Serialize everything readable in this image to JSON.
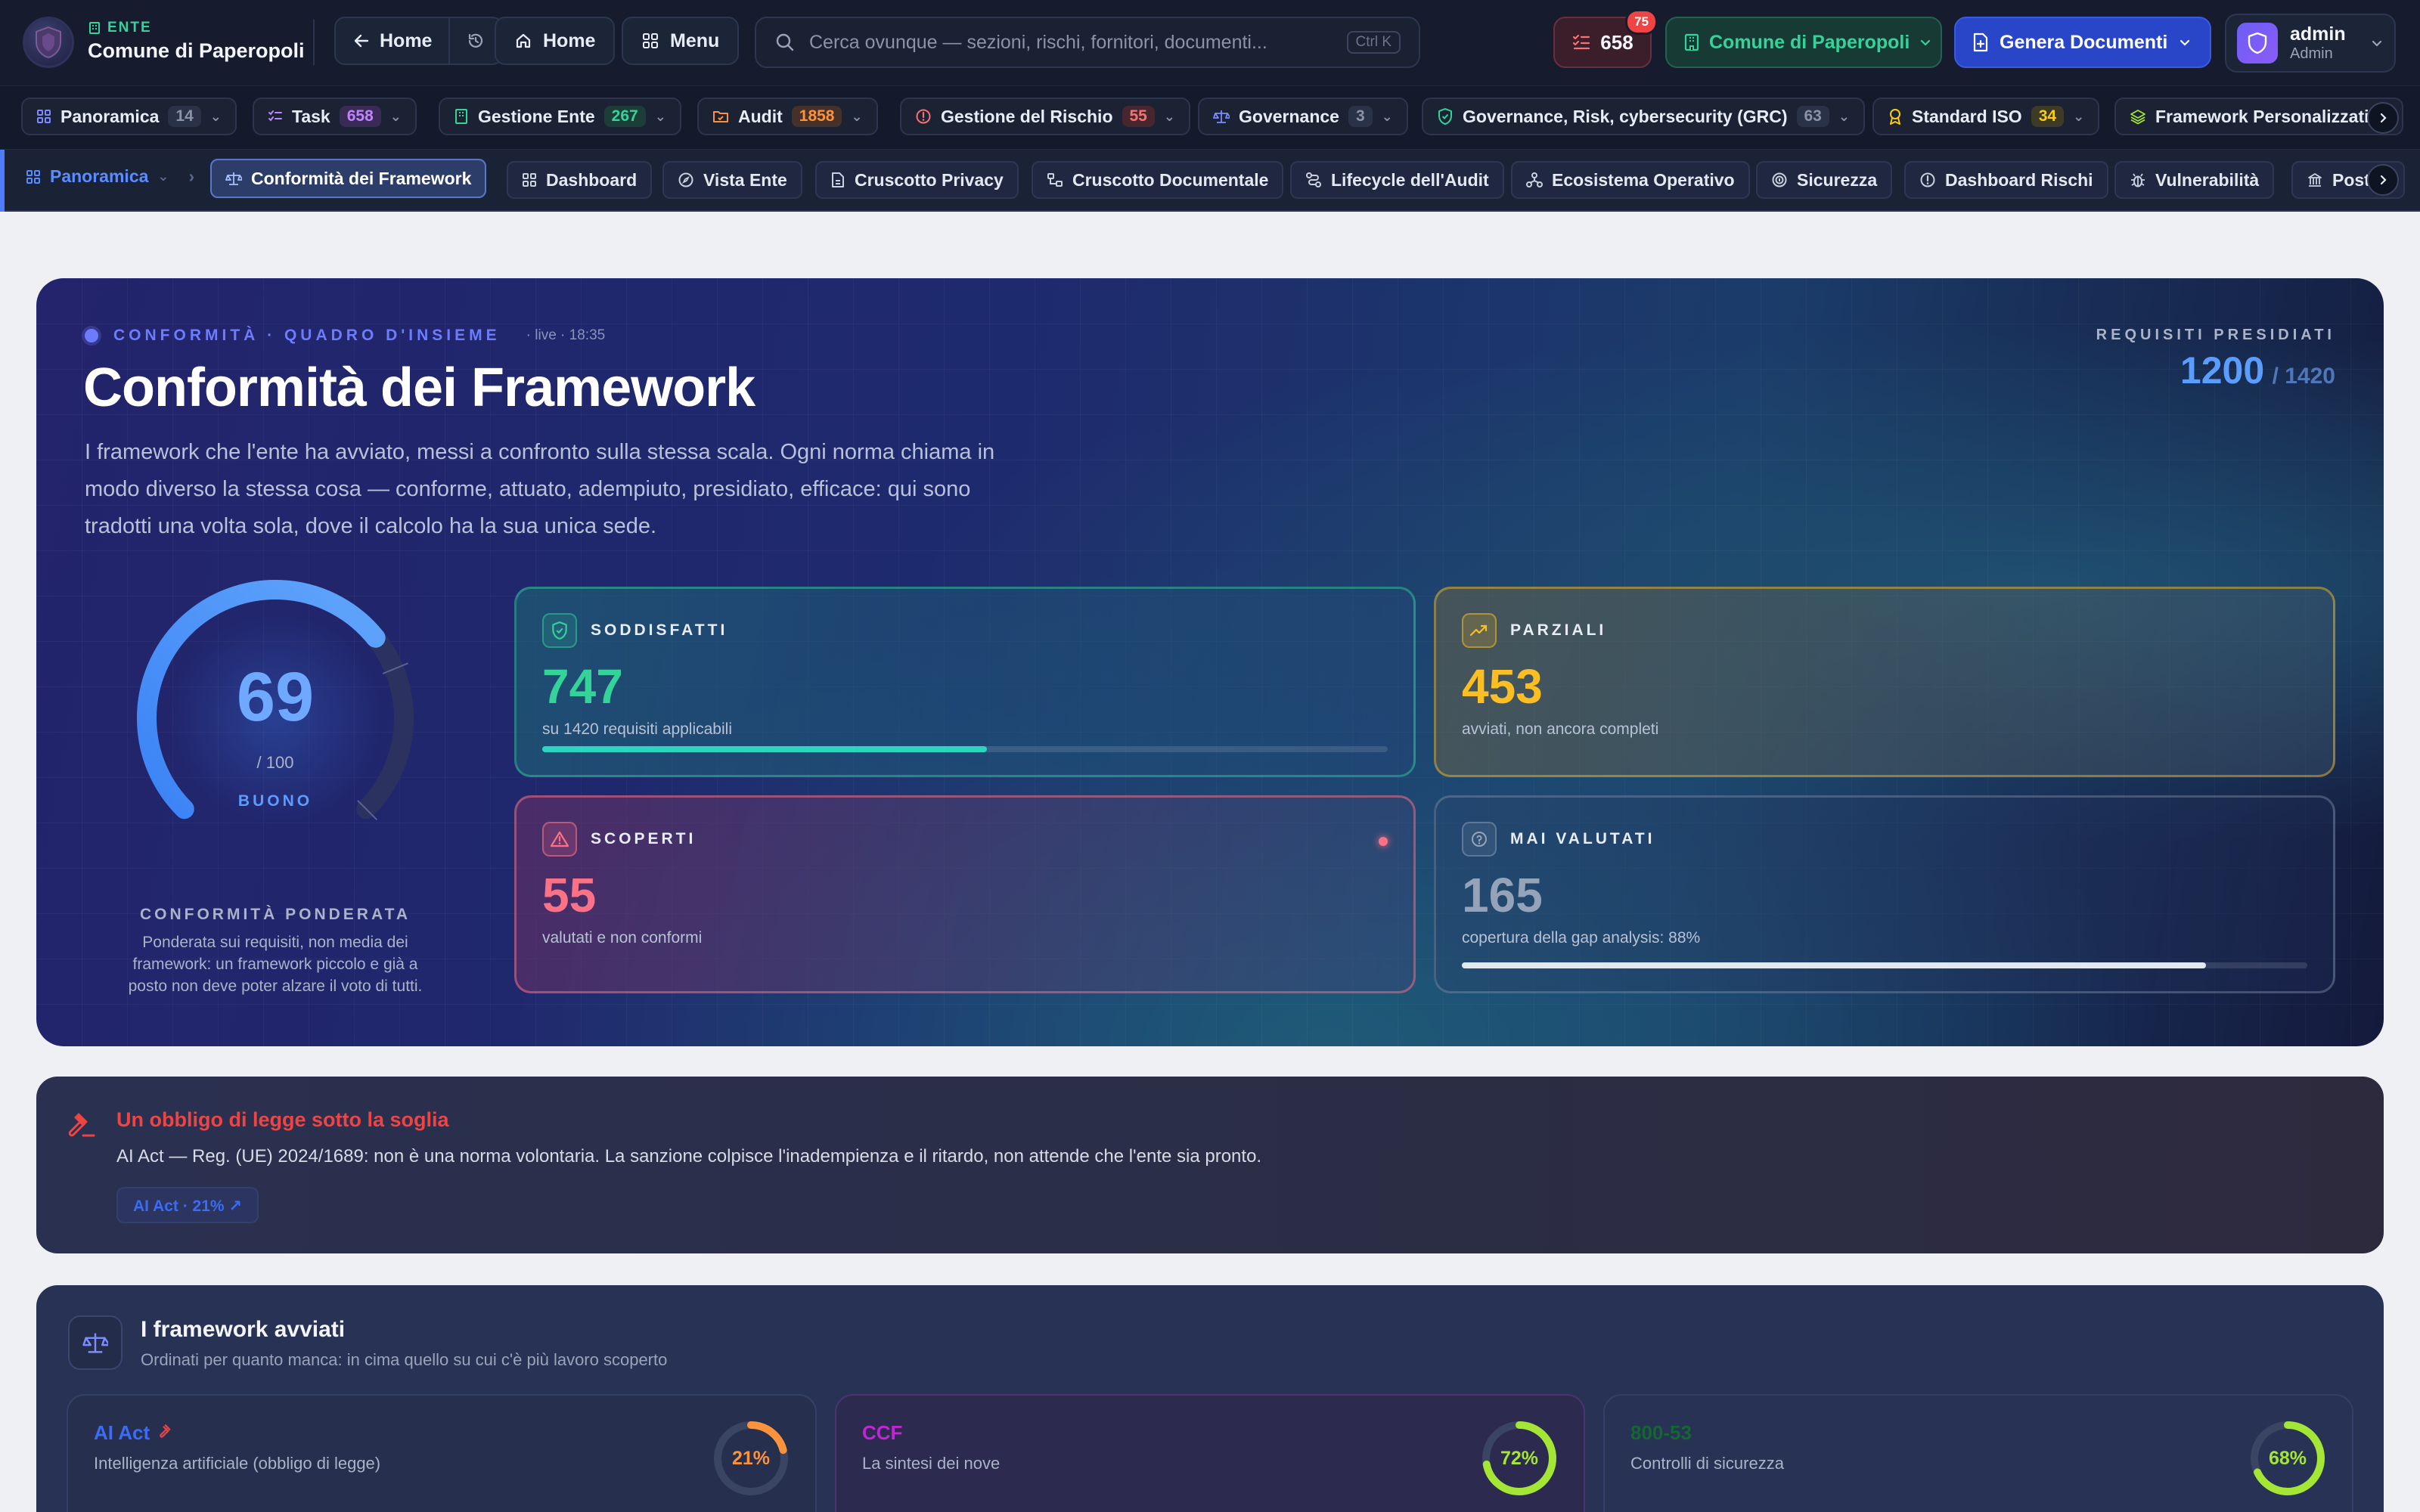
{
  "header": {
    "entity_kicker": "ENTE",
    "entity_name": "Comune di Paperopoli",
    "back_label": "Home",
    "home_label": "Home",
    "menu_label": "Menu",
    "search_placeholder": "Cerca ovunque — sezioni, rischi, fornitori, documenti...",
    "search_shortcut": "Ctrl K",
    "tasks_count": "658",
    "tasks_badge": "75",
    "entity_selector": "Comune di Paperopoli",
    "generate_docs": "Genera Documenti",
    "user_name": "admin",
    "user_role": "Admin"
  },
  "module_tabs": [
    {
      "label": "Panoramica",
      "count": "14",
      "icon": "grid-icon",
      "count_color": "#8a93a8",
      "count_bg": "#2a3248"
    },
    {
      "label": "Task",
      "count": "658",
      "icon": "tasks-icon",
      "count_color": "#c084fc",
      "count_bg": "#3a2a56"
    },
    {
      "label": "Gestione Ente",
      "count": "267",
      "icon": "building-icon",
      "count_color": "#34d399",
      "count_bg": "#1d3d38"
    },
    {
      "label": "Audit",
      "count": "1858",
      "icon": "folder-icon",
      "count_color": "#fb923c",
      "count_bg": "#45302a"
    },
    {
      "label": "Gestione del Rischio",
      "count": "55",
      "icon": "alert-circle-icon",
      "count_color": "#f87171",
      "count_bg": "#47272f"
    },
    {
      "label": "Governance",
      "count": "3",
      "icon": "scale-icon",
      "count_color": "#8a93a8",
      "count_bg": "#2a3248"
    },
    {
      "label": "Governance, Risk, cybersecurity (GRC)",
      "count": "63",
      "icon": "shield-check-icon",
      "count_color": "#8a93a8",
      "count_bg": "#2a3248"
    },
    {
      "label": "Standard ISO",
      "count": "34",
      "icon": "award-icon",
      "count_color": "#facc15",
      "count_bg": "#3d3a26"
    },
    {
      "label": "Framework Personalizzati",
      "count": "",
      "icon": "layers-icon",
      "count_color": "#8a93a8",
      "count_bg": "#2a3248"
    }
  ],
  "sub_nav": {
    "breadcrumb_root": "Panoramica",
    "active": "Conformità dei Framework",
    "items": [
      "Dashboard",
      "Vista Ente",
      "Cruscotto Privacy",
      "Cruscotto Documentale",
      "Lifecycle dell'Audit",
      "Ecosistema Operativo",
      "Sicurezza",
      "Dashboard Rischi",
      "Vulnerabilità",
      "Post"
    ]
  },
  "hero": {
    "kicker": "CONFORMITÀ · QUADRO D'INSIEME",
    "live": "· live · 18:35",
    "title": "Conformità dei Framework",
    "description_lines": [
      "I framework che l'ente ha avviato, messi a confronto sulla stessa scala. Ogni norma chiama in",
      "modo diverso la stessa cosa — conforme, attuato, adempiuto, presidiato, efficace: qui sono",
      "tradotti una volta sola, dove il calcolo ha la sua unica sede."
    ],
    "requirements_label": "REQUISITI PRESIDIATI",
    "requirements_value": "1200",
    "requirements_total": "/ 1420",
    "gauge_value": "69",
    "gauge_max": "/ 100",
    "gauge_fraction": 0.69,
    "gauge_rating": "BUONO",
    "gauge_caption": "CONFORMITÀ PONDERATA",
    "gauge_note_lines": [
      "Ponderata sui requisiti, non media dei",
      "framework: un framework piccolo e già a",
      "posto non deve poter alzare il voto di tutti."
    ]
  },
  "kpis": {
    "satisfied": {
      "label": "SODDISFATTI",
      "value": "747",
      "sub": "su 1420 requisiti applicabili",
      "progress": 0.526,
      "color": "#34d399"
    },
    "partial": {
      "label": "PARZIALI",
      "value": "453",
      "sub": "avviati, non ancora completi",
      "color": "#fbbf24"
    },
    "uncovered": {
      "label": "SCOPERTI",
      "value": "55",
      "sub": "valutati e non conformi",
      "color": "#fb7185"
    },
    "never": {
      "label": "MAI VALUTATI",
      "value": "165",
      "sub": "copertura della gap analysis: 88%",
      "progress": 0.88,
      "color": "#94a3b8"
    }
  },
  "alert": {
    "title": "Un obbligo di legge sotto la soglia",
    "text": "AI Act — Reg. (UE) 2024/1689: non è una norma volontaria. La sanzione colpisce l'inadempienza e il ritardo, non attende che l'ente sia pronto.",
    "link": "AI Act · 21% ↗"
  },
  "frameworks": {
    "title": "I framework avviati",
    "subtitle": "Ordinati per quanto manca: in cima quello su cui c'è più lavoro scoperto",
    "items": [
      {
        "name": "AI Act",
        "desc": "Intelligenza artificiale (obbligo di legge)",
        "percent": "21%",
        "fraction": 0.21,
        "color": "#fb923c",
        "name_color": "#3b6cf6"
      },
      {
        "name": "CCF",
        "desc": "La sintesi dei nove",
        "percent": "72%",
        "fraction": 0.72,
        "color": "#a3e635",
        "name_color": "#c026d3"
      },
      {
        "name": "800-53",
        "desc": "Controlli di sicurezza",
        "percent": "68%",
        "fraction": 0.68,
        "color": "#a3e635",
        "name_color": "#166534"
      }
    ]
  }
}
